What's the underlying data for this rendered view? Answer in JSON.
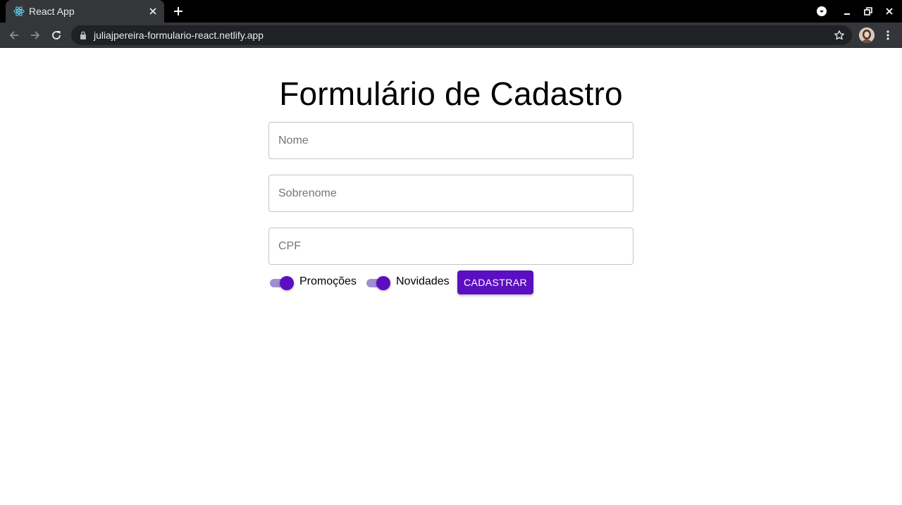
{
  "browser": {
    "tab": {
      "title": "React App",
      "favicon": "react-logo-icon"
    },
    "url": "juliajpereira-formulario-react.netlify.app",
    "icons": {
      "new_tab": "plus-icon",
      "back": "arrow-left-icon",
      "forward": "arrow-right-icon",
      "reload": "reload-icon",
      "lock": "lock-icon",
      "bookmark": "star-icon",
      "menu": "kebab-menu-icon"
    },
    "colors": {
      "tabbar": "#000000",
      "toolbar": "#35363a",
      "omnibox": "#202124"
    }
  },
  "form": {
    "title": "Formulário de Cadastro",
    "fields": {
      "nome": {
        "placeholder": "Nome",
        "value": ""
      },
      "sobrenome": {
        "placeholder": "Sobrenome",
        "value": ""
      },
      "cpf": {
        "placeholder": "CPF",
        "value": ""
      }
    },
    "switches": {
      "promocoes": {
        "label": "Promoções",
        "checked": true
      },
      "novidades": {
        "label": "Novidades",
        "checked": true
      }
    },
    "submit_label": "CADASTRAR",
    "colors": {
      "accent": "#5c0fc2",
      "switch_track": "#9f8fd1",
      "field_border": "#c4c4c4"
    }
  }
}
